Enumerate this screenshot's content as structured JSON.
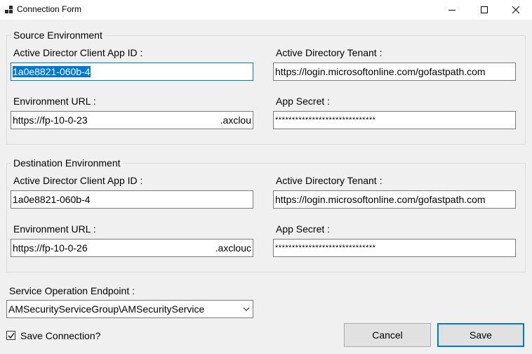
{
  "window": {
    "title": "Connection Form",
    "controls": {
      "minimize": "minimize-icon",
      "maximize": "maximize-icon",
      "close": "close-icon"
    }
  },
  "source": {
    "legend": "Source Environment",
    "client_id_label": "Active Director Client App ID :",
    "client_id_value": "1a0e8821-060b-4",
    "tenant_label": "Active Directory Tenant :",
    "tenant_value": "https://login.microsoftonline.com/gofastpath.com",
    "env_url_label": "Environment URL :",
    "env_url_value": "https://fp-10-0-23",
    "env_url_tail": ".axclou",
    "secret_label": "App Secret :",
    "secret_value": "******************************"
  },
  "destination": {
    "legend": "Destination Environment",
    "client_id_label": "Active Director Client App ID :",
    "client_id_value": "1a0e8821-060b-4",
    "tenant_label": "Active Directory Tenant :",
    "tenant_value": "https://login.microsoftonline.com/gofastpath.com",
    "env_url_label": "Environment URL :",
    "env_url_value": "https://fp-10-0-26",
    "env_url_tail": ".axclouc",
    "secret_label": "App Secret :",
    "secret_value": "******************************"
  },
  "service": {
    "label": "Service Operation Endpoint :",
    "selected": "AMSecurityServiceGroup\\AMSecurityService"
  },
  "save_connection": {
    "label": "Save Connection?",
    "checked": true
  },
  "buttons": {
    "cancel": "Cancel",
    "save": "Save"
  },
  "colors": {
    "accent": "#0078d7",
    "background": "#f0f0f0"
  }
}
